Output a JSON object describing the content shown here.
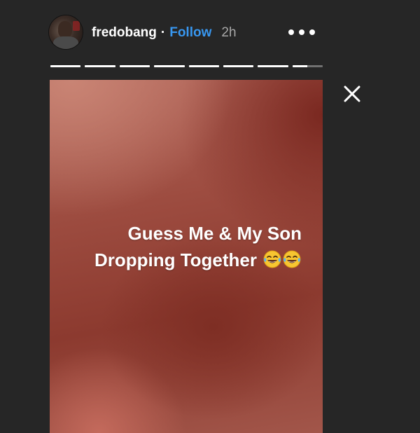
{
  "header": {
    "username": "fredobang",
    "separator": "·",
    "follow_label": "Follow",
    "time_ago": "2h"
  },
  "icons": {
    "more": "more-horizontal-icon",
    "close": "close-icon",
    "emoji": "face-with-tears-of-joy-icon"
  },
  "progress": {
    "segments": [
      1,
      1,
      1,
      1,
      1,
      1,
      1,
      0.5
    ]
  },
  "story": {
    "caption_line1": "Guess Me & My Son",
    "caption_line2": "Dropping Together",
    "emoji_count": 2
  },
  "colors": {
    "background": "#262626",
    "accent_follow": "#3897f0",
    "story_base": "#9d4c40"
  }
}
